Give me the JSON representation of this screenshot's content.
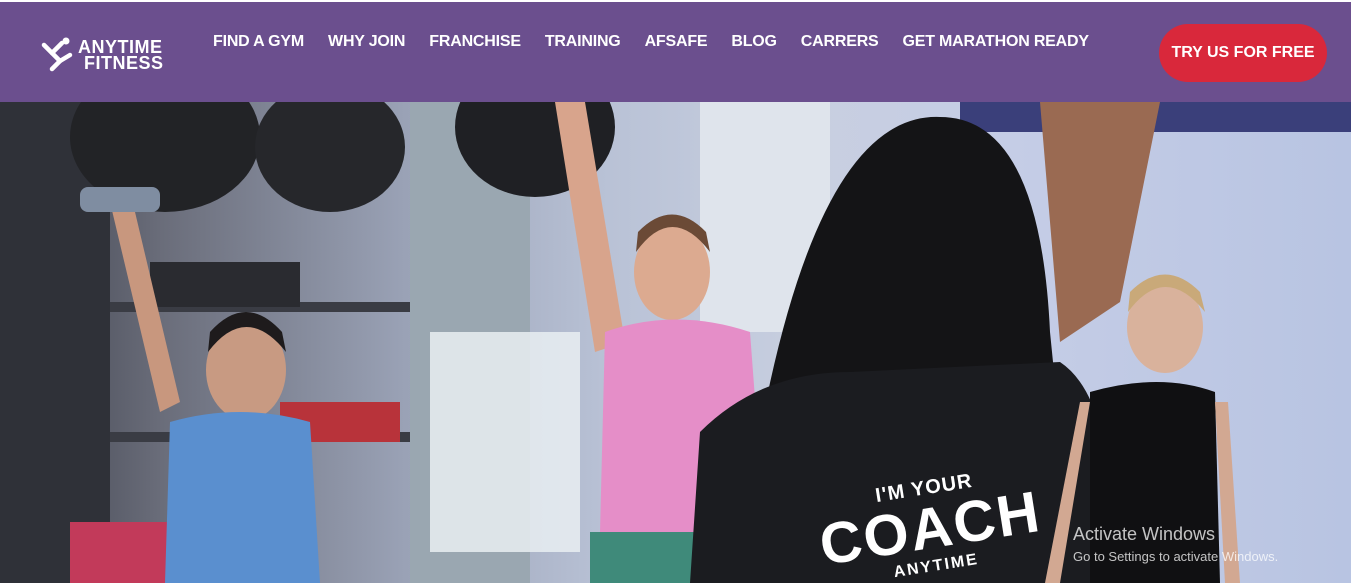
{
  "brand": {
    "logo_line1": "ANYTIME",
    "logo_line2": "FITNESS"
  },
  "nav": {
    "items": [
      {
        "label": "FIND A GYM"
      },
      {
        "label": "WHY JOIN"
      },
      {
        "label": "FRANCHISE"
      },
      {
        "label": "TRAINING"
      },
      {
        "label": "AFSAFE"
      },
      {
        "label": "BLOG"
      },
      {
        "label": "CARRERS"
      },
      {
        "label": "GET MARATHON READY"
      }
    ],
    "cta_label": "TRY US FOR FREE"
  },
  "hero": {
    "shirt_line1": "I'M YOUR",
    "shirt_line2": "COACH",
    "shirt_line3": "ANYTIME"
  },
  "os_watermark": {
    "title": "Activate Windows",
    "subtitle": "Go to Settings to activate Windows."
  },
  "colors": {
    "nav_bg": "#6b4f8e",
    "cta_bg": "#d9283b",
    "text_on_nav": "#ffffff"
  }
}
